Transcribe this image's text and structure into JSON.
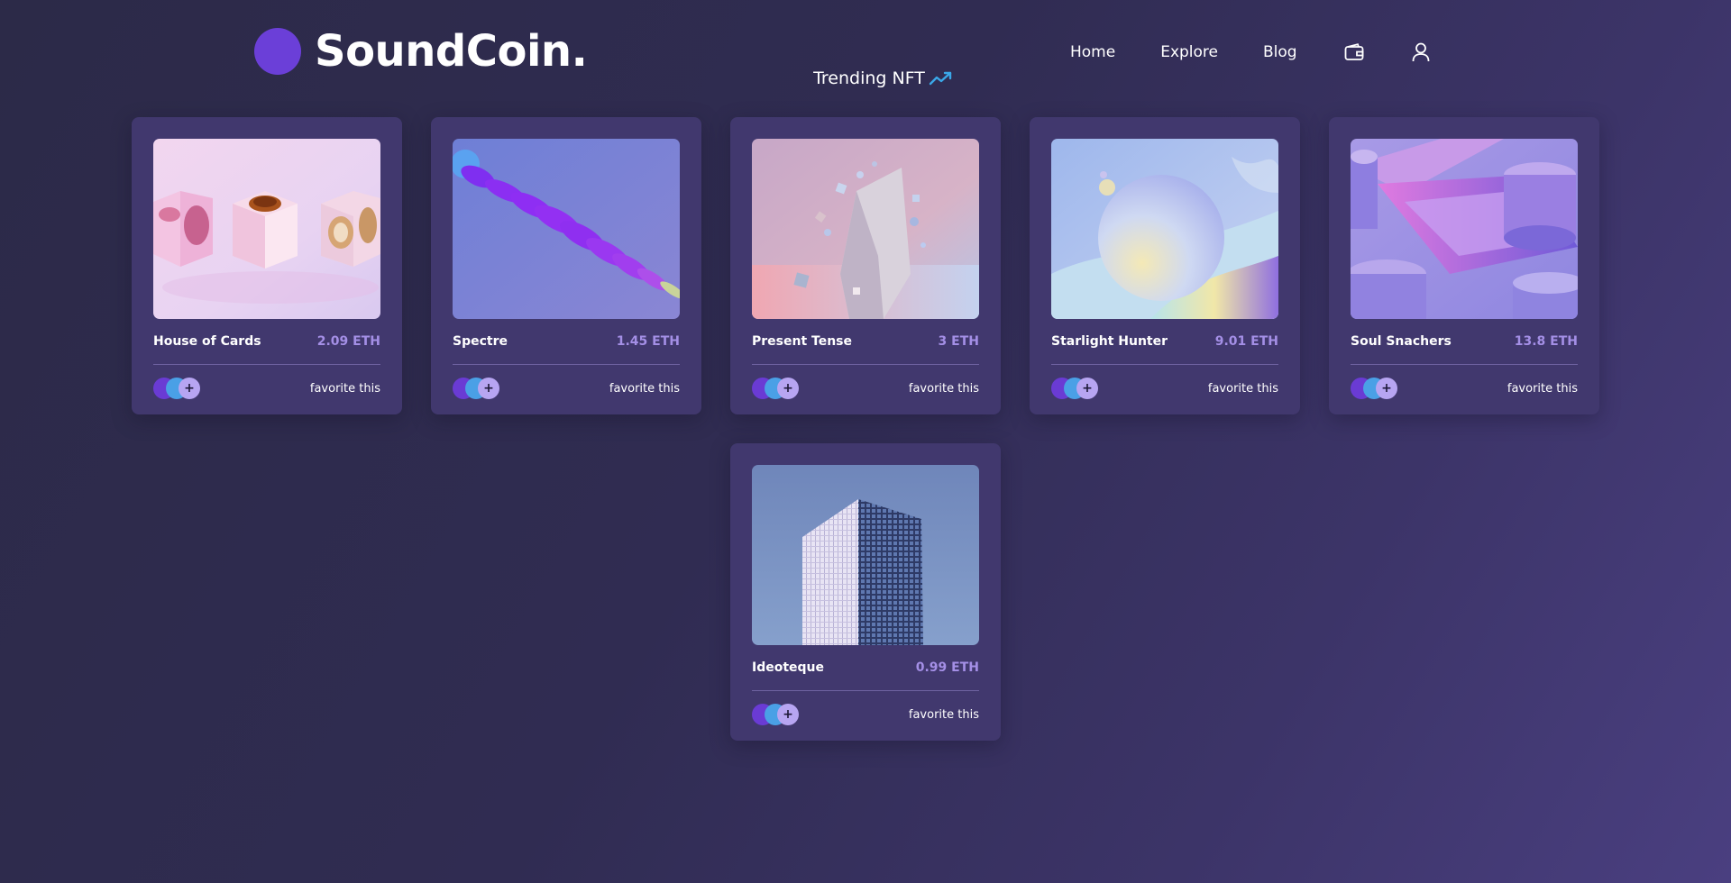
{
  "brand": {
    "name": "SoundCoin."
  },
  "nav": {
    "home": "Home",
    "explore": "Explore",
    "blog": "Blog"
  },
  "section": {
    "title": "Trending NFT"
  },
  "cards": [
    {
      "title": "House of Cards",
      "price": "2.09 ETH",
      "favorite": "favorite this",
      "more": "+"
    },
    {
      "title": "Spectre",
      "price": "1.45 ETH",
      "favorite": "favorite this",
      "more": "+"
    },
    {
      "title": "Present Tense",
      "price": "3 ETH",
      "favorite": "favorite this",
      "more": "+"
    },
    {
      "title": "Starlight Hunter",
      "price": "9.01 ETH",
      "favorite": "favorite this",
      "more": "+"
    },
    {
      "title": "Soul Snachers",
      "price": "13.8 ETH",
      "favorite": "favorite this",
      "more": "+"
    },
    {
      "title": "Ideoteque",
      "price": "0.99 ETH",
      "favorite": "favorite this",
      "more": "+"
    }
  ],
  "icons": {
    "wallet": "wallet-icon",
    "user": "user-icon",
    "trending": "trending-up-icon"
  },
  "colors": {
    "brand": "#6b3fd8",
    "price": "#a48fe6",
    "card": "#41386e",
    "trend": "#3aa7e8"
  }
}
